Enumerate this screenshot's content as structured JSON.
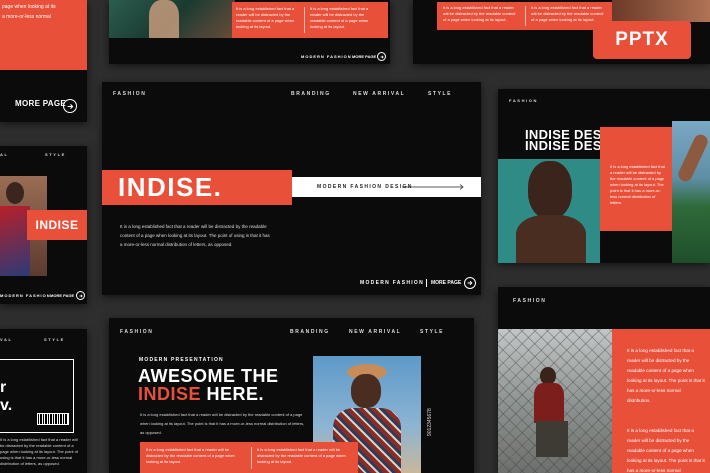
{
  "badge": "PPTX",
  "brand": "INDISE",
  "nav": {
    "section": "FASHION",
    "items": [
      "BRANDING",
      "NEW ARRIVAL",
      "STYLE"
    ]
  },
  "main": {
    "title": "INDISE.",
    "band_label": "MODERN FASHION DESIGN",
    "body": "It is a long established fact that a reader will be distracted by the readable content of a page when looking at its layout. The point of using is that it has a more-or-less normal distribution of letters, as opposed.",
    "footer_label": "MODERN FASHION",
    "more": "MORE PAGE"
  },
  "topleft": {
    "text": "page when looking at its\na more-or-less normal",
    "more": "MORE PAGE"
  },
  "topmid": {
    "text": "It is a long established fact that a reader will be distracted by the readable content of a page when looking at its layout.",
    "footer_label": "MODERN FASHION",
    "more": "MORE PAGE"
  },
  "right1": {
    "line1": "INDISE DESIGN.",
    "line2": "INDISE DESIGN.",
    "text": "It is a long established fact that a reader will be distracted by the readable content of a page when looking at its layout. The point is that it has a more-or-less normal distribution of letters."
  },
  "left2": {
    "label": "INDISE",
    "footer_label": "MODERN FASHION",
    "more": "MORE PAGE"
  },
  "bottom": {
    "kicker": "MODERN PRESENTATION",
    "title_a": "AWESOME THE",
    "title_b_red": "INDISE",
    "title_b_rest": " HERE.",
    "body": "It is a long established fact that a reader will be distracted by the readable content of a page when looking at its layout. The point is that it has a more-or-less normal distribution of letters, as opposed.",
    "barcode": "9012345678"
  },
  "right2": {
    "text": "It is a long established fact that a reader will be distracted by the readable content of a page when looking at its layout. The point is that it has a more-or-less normal distribution."
  },
  "left3": {
    "letter": "r",
    "letter2": "v."
  },
  "colors": {
    "accent": "#e8503a",
    "slide": "#0b0b0b",
    "background": "#2e2e2e"
  }
}
